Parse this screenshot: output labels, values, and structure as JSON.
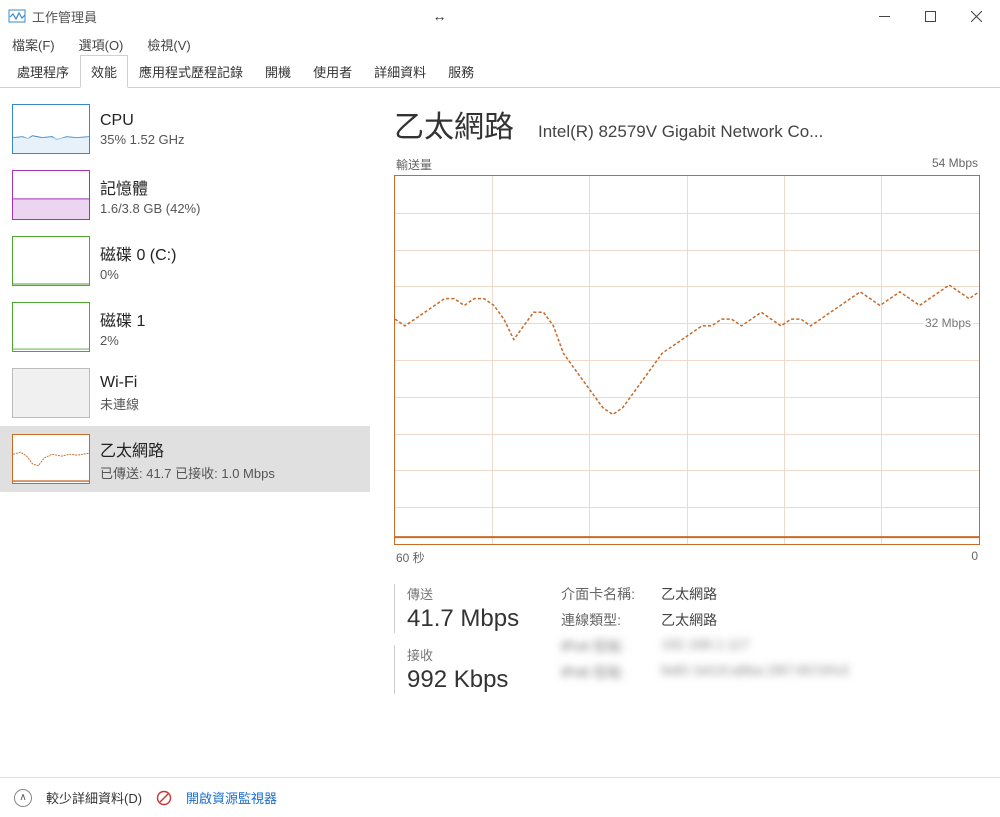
{
  "window": {
    "title": "工作管理員"
  },
  "menu": {
    "file": "檔案(F)",
    "options": "選項(O)",
    "view": "檢視(V)"
  },
  "tabs": {
    "processes": "處理程序",
    "performance": "效能",
    "app_history": "應用程式歷程記錄",
    "startup": "開機",
    "users": "使用者",
    "details": "詳細資料",
    "services": "服務"
  },
  "sidebar": {
    "cpu": {
      "title": "CPU",
      "sub": "35% 1.52 GHz"
    },
    "memory": {
      "title": "記憶體",
      "sub": "1.6/3.8 GB (42%)"
    },
    "disk0": {
      "title": "磁碟 0 (C:)",
      "sub": "0%"
    },
    "disk1": {
      "title": "磁碟 1",
      "sub": "2%"
    },
    "wifi": {
      "title": "Wi-Fi",
      "sub": "未連線"
    },
    "ethernet": {
      "title": "乙太網路",
      "sub": "已傳送: 41.7 已接收: 1.0 Mbps"
    }
  },
  "main": {
    "title": "乙太網路",
    "adapter": "Intel(R) 82579V Gigabit Network Co...",
    "chart_top_left": "輸送量",
    "chart_top_right": "54 Mbps",
    "chart_mid_label": "32 Mbps",
    "chart_bottom_left": "60 秒",
    "chart_bottom_right": "0",
    "stats": {
      "send_label": "傳送",
      "send_value": "41.7 Mbps",
      "recv_label": "接收",
      "recv_value": "992 Kbps"
    },
    "info": {
      "adapter_name_k": "介面卡名稱:",
      "adapter_name_v": "乙太網路",
      "conn_type_k": "連線類型:",
      "conn_type_v": "乙太網路",
      "ipv4_k": "IPv4 位址:",
      "ipv4_v": "192.168.1.117",
      "ipv6_k": "IPv6 位址:",
      "ipv6_v": "fe80::b419:a8ba:1f87:857d%3"
    }
  },
  "footer": {
    "fewer": "較少詳細資料(D)",
    "resmon": "開啟資源監視器"
  },
  "chart_data": {
    "type": "line",
    "title": "輸送量",
    "xlabel": "60 秒",
    "ylabel": "",
    "ylim": [
      0,
      54
    ],
    "x_range_seconds": [
      60,
      0
    ],
    "series": [
      {
        "name": "傳送",
        "style": "dashed",
        "color": "#c86b29",
        "values": [
          33,
          32,
          33,
          34,
          35,
          36,
          36,
          35,
          36,
          36,
          35,
          33,
          30,
          32,
          34,
          34,
          32,
          28,
          26,
          24,
          22,
          20,
          19,
          20,
          22,
          24,
          26,
          28,
          29,
          30,
          31,
          32,
          32,
          33,
          33,
          32,
          33,
          34,
          33,
          32,
          33,
          33,
          32,
          33,
          34,
          35,
          36,
          37,
          36,
          35,
          36,
          37,
          36,
          35,
          36,
          37,
          38,
          37,
          36,
          37
        ]
      },
      {
        "name": "接收",
        "style": "solid",
        "color": "#c86b29",
        "values": [
          1,
          1,
          1,
          1,
          1,
          1,
          1,
          1,
          1,
          1,
          1,
          1,
          1,
          1,
          1,
          1,
          1,
          1,
          1,
          1,
          1,
          1,
          1,
          1,
          1,
          1,
          1,
          1,
          1,
          1,
          1,
          1,
          1,
          1,
          1,
          1,
          1,
          1,
          1,
          1,
          1,
          1,
          1,
          1,
          1,
          1,
          1,
          1,
          1,
          1,
          1,
          1,
          1,
          1,
          1,
          1,
          1,
          1,
          1,
          1
        ]
      }
    ]
  }
}
